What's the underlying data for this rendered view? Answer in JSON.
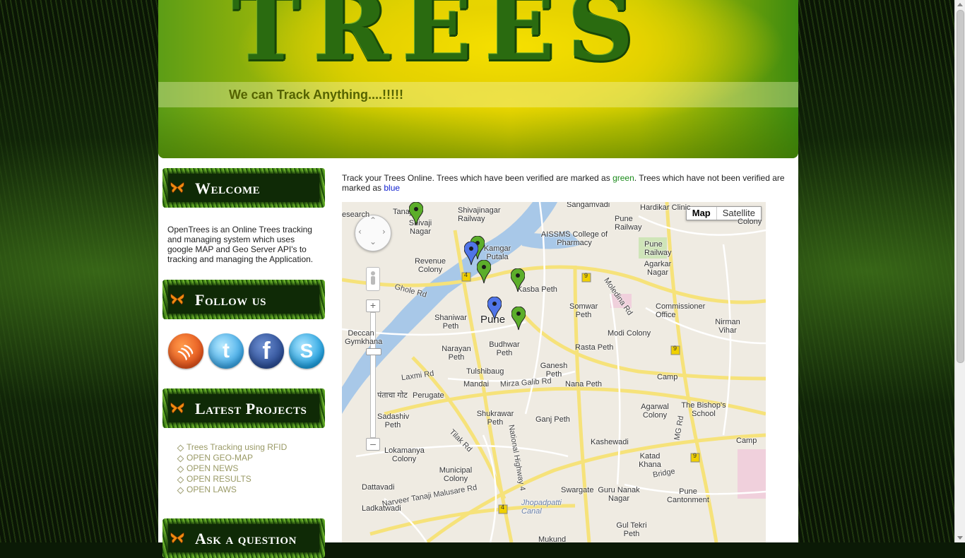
{
  "header": {
    "logo_text": "TREES",
    "tagline": "We can Track Anything....!!!!!"
  },
  "sidebar": {
    "welcome_title": "Welcome",
    "welcome_text": "OpenTrees is an Online Trees tracking and managing system which uses google MAP and Geo Server API's to tracking and managing the Application.",
    "follow_title": "Follow us",
    "social": [
      {
        "name": "rss-icon",
        "glyph": ")))"
      },
      {
        "name": "twitter-icon",
        "glyph": "t"
      },
      {
        "name": "facebook-icon",
        "glyph": "f"
      },
      {
        "name": "skype-icon",
        "glyph": "S"
      }
    ],
    "projects_title": "Latest Projects",
    "projects": [
      "Trees Tracking using RFID",
      "OPEN GEO-MAP",
      "OPEN NEWS",
      "OPEN RESULTS",
      "OPEN LAWS"
    ],
    "question_title": "Ask a question"
  },
  "intro": {
    "part1": "Track your Trees Online. Trees which have been verified are marked as ",
    "green_word": "green",
    "part2": ". Trees which have not been verified are marked as ",
    "blue_word": "blue"
  },
  "map": {
    "type_map": "Map",
    "type_satellite": "Satellite",
    "labels": {
      "sangamvadi": "Sangamvadi",
      "shivajinagar_railway": "Shivajinagar Railway",
      "tanaji": "Tanaji",
      "shivaji_nagar": "Shivaji Nagar",
      "search": "esearch",
      "aissms": "AISSMS College of Pharmacy",
      "pune_railway1": "Pune Railway",
      "pune_railway2": "Pune Railway",
      "clinic": "Hardikar Clinic",
      "colony": "Colony",
      "revenue_colony": "Revenue Colony",
      "raviwar": "Rasta Peth",
      "kamgar_putala": "Kamgar Putala",
      "agarkar_nagar": "Agarkar Nagar",
      "ghole_rd": "Ghole Rd",
      "kasba_peth": "Kasba Peth",
      "commissioner": "Commissioner Office",
      "nirman_vihar": "Nirman Vihar",
      "shaniwar_peth": "Shaniwar Peth",
      "pune": "Pune",
      "somwar_peth": "Somwar Peth",
      "modi_colony": "Modi Colony",
      "moledina": "Moledina Rd",
      "deccan": "Deccan Gymkhana",
      "narayan_peth": "Narayan Peth",
      "budhwar_peth": "Budhwar Peth",
      "rasta_peth": "Rasta Peth",
      "tulshibaug": "Tulshibaug",
      "ganesh_peth": "Ganesh Peth",
      "laxmi_rd": "Laxmi Rd",
      "mandai": "Mandai",
      "mirza_galib": "Mirza Galib Rd",
      "nana_peth": "Nana Peth",
      "camp": "Camp",
      "devnagari": "पंताचा गोट",
      "perugate": "Perugate",
      "bishops": "The Bishop's School",
      "agarwal_colony": "Agarwal Colony",
      "sadashiv_peth": "Sadashiv Peth",
      "shukrawar_peth": "Shukrawar Peth",
      "ganj_peth": "Ganj Peth",
      "mg_rd": "MG Rd",
      "tilak_rd": "Tilak Rd",
      "national_highway": "National Highway 4",
      "kashewadi": "Kashewadi",
      "camp2": "Camp",
      "lokamanya": "Lokamanya Colony",
      "katad_khana": "Katad Khana",
      "municipal_colony": "Municipal Colony",
      "bridge": "Bridge",
      "dattavadi": "Dattavadi",
      "narveer": "Narveer Tanaji Malusare Rd",
      "jhopadpatti": "Jhopadpatti Canal",
      "swargate": "Swargate",
      "guru_nanak": "Guru Nanak Nagar",
      "pune_cantonment": "Pune Cantonment",
      "ladkatwadi": "Ladkatwadi",
      "gul_tekri": "Gul Tekri Peth",
      "mukund": "Mukund",
      "route_9a": "9",
      "route_9b": "9",
      "route_9c": "9",
      "route_4a": "4",
      "route_4b": "4"
    },
    "markers": [
      {
        "status": "verified",
        "color": "#5cae2a",
        "label": "green-marker"
      },
      {
        "status": "verified",
        "color": "#5cae2a",
        "label": "green-marker"
      },
      {
        "status": "unverified",
        "color": "#5075e8",
        "label": "blue-marker"
      },
      {
        "status": "verified",
        "color": "#5cae2a",
        "label": "green-marker"
      },
      {
        "status": "verified",
        "color": "#5cae2a",
        "label": "green-marker"
      },
      {
        "status": "unverified",
        "color": "#5075e8",
        "label": "blue-marker"
      },
      {
        "status": "verified",
        "color": "#5cae2a",
        "label": "green-marker"
      }
    ]
  },
  "colors": {
    "verified": "#1a8a1a",
    "unverified": "#1020d0",
    "project_link": "#9a9a66",
    "tagline": "#556300"
  }
}
